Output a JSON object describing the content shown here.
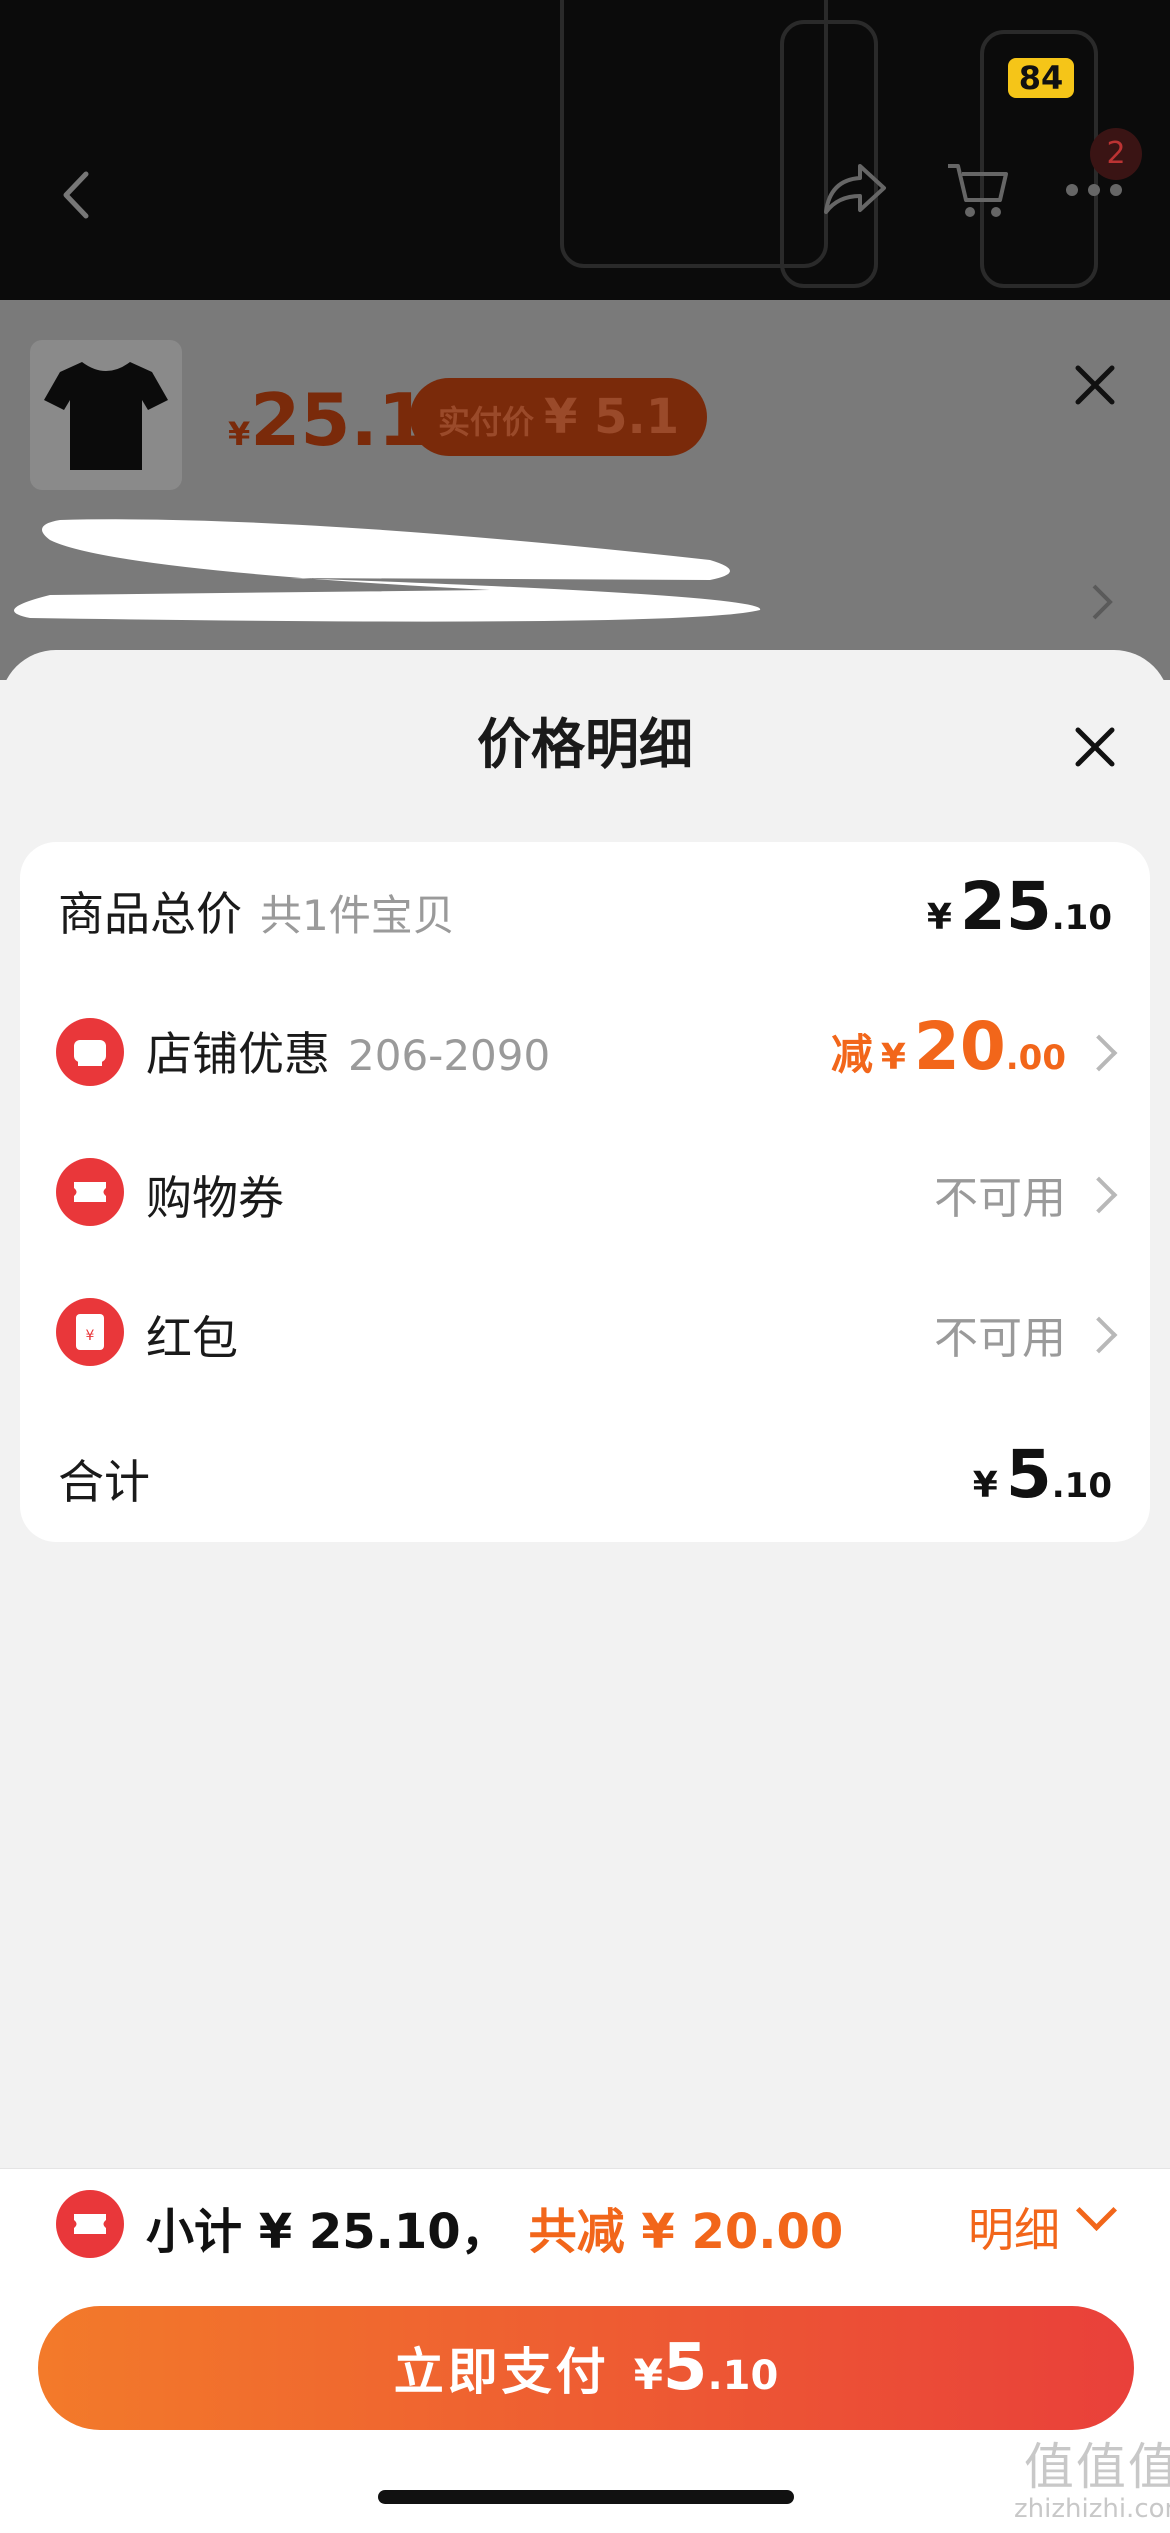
{
  "header": {
    "badge": "84",
    "cart_count": "2",
    "back_icon": "chevron-left-icon",
    "share_icon": "share-icon",
    "cart_icon": "cart-icon",
    "more_icon": "more-icon"
  },
  "sku": {
    "currency": "¥",
    "price": "25.1",
    "paid_label": "实付价",
    "paid_price": "¥ 5.1"
  },
  "sheet": {
    "title": "价格明细",
    "rows": [
      {
        "label": "商品总价",
        "sub": "共1件宝贝",
        "currency": "¥",
        "amount_int": "25",
        "amount_dec": ".10"
      },
      {
        "label": "店铺优惠",
        "sub": "206-2090",
        "prefix": "减",
        "currency": "¥",
        "amount_int": "20",
        "amount_dec": ".00",
        "icon": "store-icon"
      },
      {
        "label": "购物券",
        "status": "不可用",
        "icon": "ticket-icon"
      },
      {
        "label": "红包",
        "status": "不可用",
        "icon": "red-envelope-icon"
      },
      {
        "label": "合计",
        "currency": "¥",
        "amount_int": "5",
        "amount_dec": ".10"
      }
    ]
  },
  "footer": {
    "subtotal_text": "小计 ¥ 25.10，",
    "discount_text": "共减 ¥ 20.00",
    "detail_label": "明细",
    "pay_label": "立即支付",
    "pay_currency": "¥",
    "pay_int": "5",
    "pay_dec": ".10"
  },
  "watermark": {
    "big": "值值值",
    "small": "zhizhizhi.com"
  },
  "colors": {
    "accent": "#f2661a",
    "red": "#e9373a",
    "button_start": "#f37a2a",
    "button_end": "#e9403a"
  }
}
